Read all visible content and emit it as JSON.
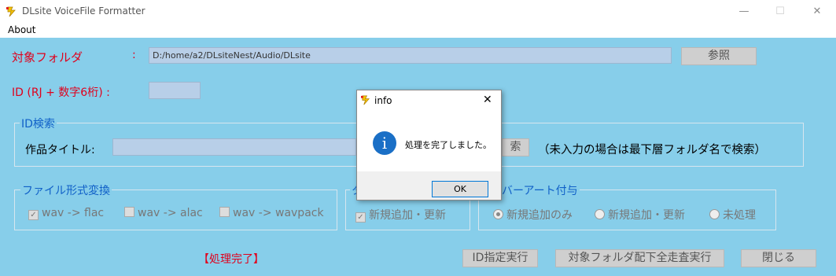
{
  "window": {
    "title": "DLsite VoiceFile Formatter",
    "min_glyph": "—",
    "max_glyph": "☐",
    "close_glyph": "✕"
  },
  "menu": {
    "about": "About"
  },
  "folder": {
    "label": "対象フォルダ",
    "colon": ":",
    "path": "D:/home/a2/DLsiteNest/Audio/DLsite",
    "browse": "参照"
  },
  "id_field": {
    "label": "ID (RJ + 数字6桁) :",
    "value": ""
  },
  "id_search": {
    "group": "ID検索",
    "title_label": "作品タイトル:",
    "search_btn": "索",
    "hint": "（未入力の場合は最下層フォルダ名で検索）"
  },
  "convert": {
    "group": "ファイル形式変換",
    "opt1": "wav -> flac",
    "opt2": "wav -> alac",
    "opt3": "wav -> wavpack"
  },
  "tag": {
    "group": "タ",
    "opt1": "新規追加・更新"
  },
  "cover": {
    "group": "バーアート付与",
    "opt1": "新規追加のみ",
    "opt2": "新規追加・更新",
    "opt3": "未処理"
  },
  "status": "【処理完了】",
  "buttons": {
    "run_id": "ID指定実行",
    "run_all": "対象フォルダ配下全走査実行",
    "close": "閉じる"
  },
  "dialog": {
    "title": "info",
    "message": "処理を完了しました。",
    "ok": "OK",
    "close_glyph": "✕",
    "icon_glyph": "i"
  },
  "colors": {
    "background": "#87ceea",
    "label_red": "#e0001c",
    "label_blue": "#1060c8",
    "info_icon": "#1a6fc6"
  },
  "icons": {
    "app": "lightning-icon",
    "dialog": "info-icon"
  }
}
